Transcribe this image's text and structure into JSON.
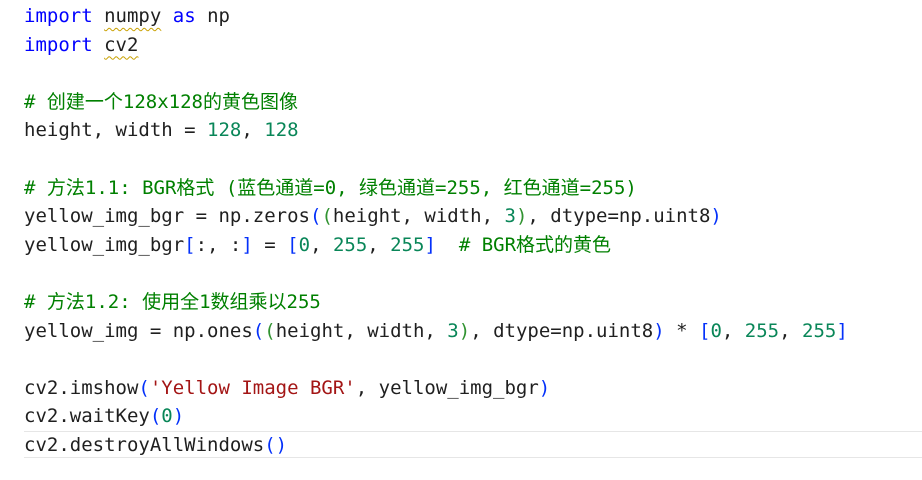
{
  "editor": {
    "lines": [
      {
        "tokens": [
          {
            "text": "import",
            "kind": "keyword"
          },
          {
            "text": " ",
            "kind": "plain"
          },
          {
            "text": "numpy",
            "kind": "module-name",
            "squiggle": true
          },
          {
            "text": " ",
            "kind": "plain"
          },
          {
            "text": "as",
            "kind": "keyword"
          },
          {
            "text": " np",
            "kind": "plain"
          }
        ]
      },
      {
        "tokens": [
          {
            "text": "import",
            "kind": "keyword"
          },
          {
            "text": " ",
            "kind": "plain"
          },
          {
            "text": "cv2",
            "kind": "module-name",
            "squiggle": true
          }
        ]
      },
      {
        "tokens": []
      },
      {
        "tokens": [
          {
            "text": "# 创建一个128x128的黄色图像",
            "kind": "comment"
          }
        ]
      },
      {
        "tokens": [
          {
            "text": "height, width = ",
            "kind": "plain"
          },
          {
            "text": "128",
            "kind": "number"
          },
          {
            "text": ", ",
            "kind": "plain"
          },
          {
            "text": "128",
            "kind": "number"
          }
        ]
      },
      {
        "tokens": []
      },
      {
        "tokens": [
          {
            "text": "# 方法1.1: BGR格式 (蓝色通道=0, 绿色通道=255, 红色通道=255)",
            "kind": "comment"
          }
        ]
      },
      {
        "tokens": [
          {
            "text": "yellow_img_bgr = np.zeros",
            "kind": "plain"
          },
          {
            "text": "(",
            "kind": "paren1"
          },
          {
            "text": "(",
            "kind": "paren2"
          },
          {
            "text": "height, width, ",
            "kind": "plain"
          },
          {
            "text": "3",
            "kind": "number"
          },
          {
            "text": ")",
            "kind": "paren2"
          },
          {
            "text": ", dtype=np.uint8",
            "kind": "plain"
          },
          {
            "text": ")",
            "kind": "paren1"
          }
        ]
      },
      {
        "tokens": [
          {
            "text": "yellow_img_bgr",
            "kind": "plain"
          },
          {
            "text": "[",
            "kind": "paren1"
          },
          {
            "text": ":, :",
            "kind": "plain"
          },
          {
            "text": "]",
            "kind": "paren1"
          },
          {
            "text": " = ",
            "kind": "plain"
          },
          {
            "text": "[",
            "kind": "paren1"
          },
          {
            "text": "0",
            "kind": "number"
          },
          {
            "text": ", ",
            "kind": "plain"
          },
          {
            "text": "255",
            "kind": "number"
          },
          {
            "text": ", ",
            "kind": "plain"
          },
          {
            "text": "255",
            "kind": "number"
          },
          {
            "text": "]",
            "kind": "paren1"
          },
          {
            "text": "  ",
            "kind": "plain"
          },
          {
            "text": "# BGR格式的黄色",
            "kind": "comment"
          }
        ]
      },
      {
        "tokens": []
      },
      {
        "tokens": [
          {
            "text": "# 方法1.2: 使用全1数组乘以255",
            "kind": "comment"
          }
        ]
      },
      {
        "tokens": [
          {
            "text": "yellow_img = np.ones",
            "kind": "plain"
          },
          {
            "text": "(",
            "kind": "paren1"
          },
          {
            "text": "(",
            "kind": "paren2"
          },
          {
            "text": "height, width, ",
            "kind": "plain"
          },
          {
            "text": "3",
            "kind": "number"
          },
          {
            "text": ")",
            "kind": "paren2"
          },
          {
            "text": ", dtype=np.uint8",
            "kind": "plain"
          },
          {
            "text": ")",
            "kind": "paren1"
          },
          {
            "text": " * ",
            "kind": "plain"
          },
          {
            "text": "[",
            "kind": "paren1"
          },
          {
            "text": "0",
            "kind": "number"
          },
          {
            "text": ", ",
            "kind": "plain"
          },
          {
            "text": "255",
            "kind": "number"
          },
          {
            "text": ", ",
            "kind": "plain"
          },
          {
            "text": "255",
            "kind": "number"
          },
          {
            "text": "]",
            "kind": "paren1"
          }
        ]
      },
      {
        "tokens": []
      },
      {
        "tokens": [
          {
            "text": "cv2.imshow",
            "kind": "plain"
          },
          {
            "text": "(",
            "kind": "paren1"
          },
          {
            "text": "'Yellow Image BGR'",
            "kind": "string"
          },
          {
            "text": ", yellow_img_bgr",
            "kind": "plain"
          },
          {
            "text": ")",
            "kind": "paren1"
          }
        ]
      },
      {
        "tokens": [
          {
            "text": "cv2.waitKey",
            "kind": "plain"
          },
          {
            "text": "(",
            "kind": "paren1"
          },
          {
            "text": "0",
            "kind": "number"
          },
          {
            "text": ")",
            "kind": "paren1"
          }
        ]
      },
      {
        "current": true,
        "tokens": [
          {
            "text": "cv2.destroyAllWindows",
            "kind": "plain"
          },
          {
            "text": "(",
            "kind": "paren1"
          },
          {
            "text": ")",
            "kind": "paren1"
          }
        ]
      }
    ]
  },
  "colors": {
    "background": "#ffffff",
    "keyword": "#0000ff",
    "comment": "#008000",
    "number": "#098658",
    "string": "#a31515",
    "plain": "#1f1f1f",
    "bracket_level_1": "#0431fa",
    "bracket_level_2": "#319331",
    "squiggle": "#c8a000",
    "current_line_border": "#e6e6e6"
  }
}
